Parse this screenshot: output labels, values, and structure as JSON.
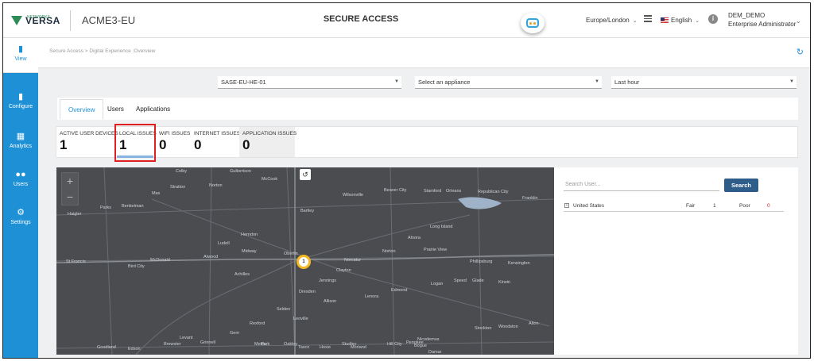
{
  "header": {
    "logo_text": "VERSA",
    "logo_sub": "NETWORKS",
    "tenant": "ACME3-EU",
    "title": "SECURE ACCESS",
    "timezone": "Europe/London",
    "language": "English",
    "user_name": "DEM_DEMO",
    "user_role": "Enterprise Administrator"
  },
  "nav": {
    "items": [
      {
        "label": "View"
      },
      {
        "label": "Configure"
      },
      {
        "label": "Analytics"
      },
      {
        "label": "Users"
      },
      {
        "label": "Settings"
      }
    ]
  },
  "breadcrumb": "Secure Access > Digital Experience :Overview",
  "filters": {
    "region": "SASE-EU-HE-01",
    "appliance": "Select an appliance",
    "time": "Last hour"
  },
  "tabs": [
    {
      "label": "Overview",
      "active": true
    },
    {
      "label": "Users",
      "active": false
    },
    {
      "label": "Applications",
      "active": false
    }
  ],
  "metrics": [
    {
      "label": "ACTIVE USER DEVICES",
      "value": "1"
    },
    {
      "label": "LOCAL ISSUES",
      "value": "1"
    },
    {
      "label": "WIFI ISSUES",
      "value": "0"
    },
    {
      "label": "INTERNET ISSUES",
      "value": "0"
    },
    {
      "label": "APPLICATION ISSUES",
      "value": "0"
    }
  ],
  "map": {
    "cluster_count": "1",
    "places": [
      "Colby",
      "Gulbertson",
      "McCook",
      "Norton",
      "Stratton",
      "Max",
      "Wilsonville",
      "Beaver City",
      "Stamford",
      "Orleans",
      "Republican City",
      "Franklin",
      "Parks",
      "Benkelman",
      "Herndon",
      "Bartley",
      "Long Island",
      "Haigler",
      "Ludell",
      "Alnora",
      "Atwood",
      "Midway",
      "Oberlin",
      "Norcatur",
      "Norton",
      "Prairie View",
      "Phillipsburg",
      "Kensington",
      "St Francis",
      "Bird City",
      "McDonald",
      "Jennings",
      "Dresden",
      "Clayton",
      "Logan",
      "Speed",
      "Glade",
      "Kirwin",
      "Achilles",
      "Lenora",
      "Edmond",
      "Brewster",
      "Levant",
      "Gem",
      "Menlo",
      "Rexford",
      "Selden",
      "Leoville",
      "Allison",
      "Goodland",
      "Edson",
      "Grinnell",
      "Park",
      "Oakley",
      "Hoxie",
      "Studley",
      "Nicodemus",
      "Bogue",
      "Stockton",
      "Woodston",
      "Alton",
      "Damar",
      "Morland",
      "Hill City",
      "Penokee",
      "Tasco"
    ]
  },
  "panel": {
    "search_placeholder": "Search User...",
    "search_label": "Search",
    "country": "United States",
    "fair_label": "Fair",
    "fair_count": "1",
    "poor_label": "Poor",
    "poor_count": "0"
  },
  "colors": {
    "nav_blue": "#1e90d6",
    "search_button": "#2f5d8a",
    "highlight": "#e02020",
    "cluster_ring": "#f5b820",
    "map_bg": "#4a4c50"
  }
}
